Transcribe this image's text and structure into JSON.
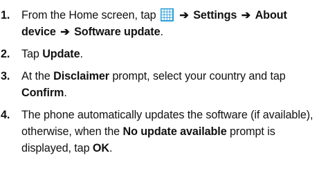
{
  "colors": {
    "text": "#111111",
    "icon": "#2f9fd6"
  },
  "icons": {
    "apps_grid": "apps-grid-icon",
    "arrow": "right-arrow-icon"
  },
  "steps": [
    {
      "number": "1.",
      "prefix": "From the Home screen, tap",
      "arrow1": "➔",
      "settings": "Settings",
      "arrow2": "➔",
      "about_device": "About device",
      "arrow3": "➔",
      "software_update": "Software update",
      "suffix": "."
    },
    {
      "number": "2.",
      "prefix": "Tap",
      "update": "Update",
      "suffix": "."
    },
    {
      "number": "3.",
      "prefix": "At the",
      "disclaimer": "Disclaimer",
      "middle": "prompt, select your country and tap",
      "confirm": "Confirm",
      "suffix": "."
    },
    {
      "number": "4.",
      "prefix": "The phone automatically updates the software (if available), otherwise, when the",
      "no_update": "No update available",
      "middle": "prompt is displayed, tap",
      "ok": "OK",
      "suffix": "."
    }
  ]
}
